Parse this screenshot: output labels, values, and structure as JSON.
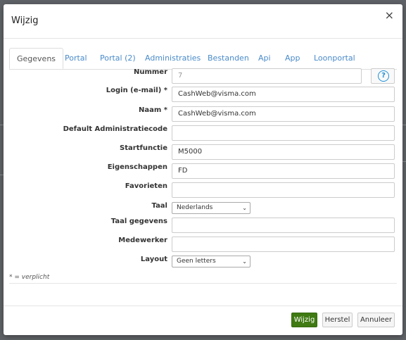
{
  "dialog": {
    "title": "Wijzig",
    "close_glyph": "×"
  },
  "tabs": [
    {
      "label": "Gegevens",
      "active": true
    },
    {
      "label": "Portal",
      "active": false
    },
    {
      "label": "Portal (2)",
      "active": false
    },
    {
      "label": "Administraties",
      "active": false
    },
    {
      "label": "Bestanden",
      "active": false
    },
    {
      "label": "Api",
      "active": false
    },
    {
      "label": "App",
      "active": false
    },
    {
      "label": "Loonportal",
      "active": false
    }
  ],
  "form": {
    "nummer": {
      "label": "Nummer",
      "value": "7"
    },
    "login": {
      "label": "Login (e-mail) *",
      "value": "CashWeb@visma.com"
    },
    "naam": {
      "label": "Naam *",
      "value": "CashWeb@visma.com"
    },
    "default_admin": {
      "label": "Default Administratiecode",
      "value": ""
    },
    "startfunctie": {
      "label": "Startfunctie",
      "value": "M5000"
    },
    "eigenschappen": {
      "label": "Eigenschappen",
      "value": "FD"
    },
    "favorieten": {
      "label": "Favorieten",
      "value": ""
    },
    "taal": {
      "label": "Taal",
      "value": "Nederlands"
    },
    "taal_gegevens": {
      "label": "Taal gegevens",
      "value": ""
    },
    "medewerker": {
      "label": "Medewerker",
      "value": ""
    },
    "layout": {
      "label": "Layout",
      "value": "Geen letters"
    },
    "help_glyph": "?",
    "chevron_glyph": "⌄"
  },
  "required_note": "* = verplicht",
  "buttons": {
    "save": "Wijzig",
    "reset": "Herstel",
    "cancel": "Annuleer"
  },
  "colors": {
    "primary_button": "#3f7a12",
    "tab_link": "#4a8bc9",
    "help_icon": "#1e90d6",
    "backdrop": "#5f6266"
  },
  "icons": [
    "close-icon",
    "help-icon",
    "chevron-down-icon"
  ]
}
